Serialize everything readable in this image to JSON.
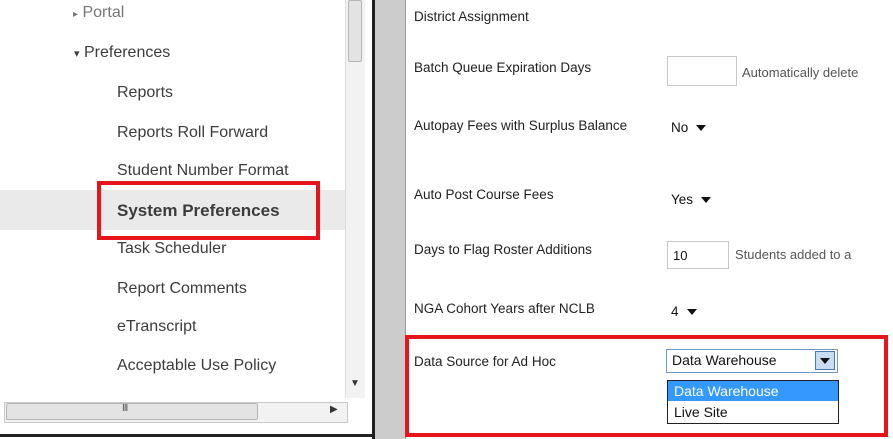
{
  "nav": {
    "items": [
      {
        "label": "Portal",
        "arrow": "▸"
      },
      {
        "label": "Preferences",
        "arrow": "▾"
      },
      {
        "label": "Reports"
      },
      {
        "label": "Reports Roll Forward"
      },
      {
        "label": "Student Number Format"
      },
      {
        "label": "System Preferences"
      },
      {
        "label": "Task Scheduler"
      },
      {
        "label": "Report Comments"
      },
      {
        "label": "eTranscript"
      },
      {
        "label": "Acceptable Use Policy"
      }
    ],
    "selected_index": 5,
    "hscroll_grip": "III"
  },
  "form": {
    "section_label": "District Assignment",
    "rows": [
      {
        "label": "Batch Queue Expiration Days",
        "value": "",
        "note": "Automatically delete"
      },
      {
        "label": "Autopay Fees with Surplus Balance",
        "value": "No"
      },
      {
        "label": "Auto Post Course Fees",
        "value": "Yes"
      },
      {
        "label": "Days to Flag Roster Additions",
        "value": "10",
        "note": "Students added to a"
      },
      {
        "label": "NGA Cohort Years after NCLB",
        "value": "4"
      },
      {
        "label": "Data Source for Ad Hoc",
        "value": "Data Warehouse"
      }
    ],
    "dropdown_options": [
      "Data Warehouse",
      "Live Site"
    ]
  },
  "colors": {
    "highlight_red": "#e8141b",
    "option_selected_bg": "#3399ff"
  }
}
